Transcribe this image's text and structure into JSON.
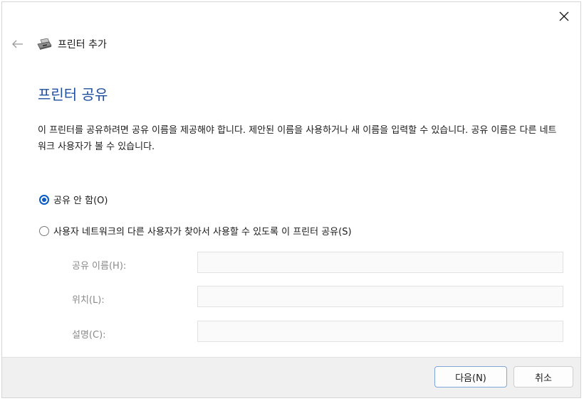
{
  "window": {
    "close_glyph": "✕",
    "back_glyph": "←",
    "wizard_title": "프린터 추가"
  },
  "page": {
    "title": "프린터 공유",
    "description": "이 프린터를 공유하려면 공유 이름을 제공해야 합니다. 제안된 이름을 사용하거나 새 이름을 입력할 수 있습니다. 공유 이름은 다른 네트워크 사용자가 볼 수 있습니다."
  },
  "options": {
    "no_share_label": "공유 안 함(O)",
    "share_label": "사용자 네트워크의 다른 사용자가 찾아서 사용할 수 있도록 이 프린터 공유(S)",
    "selected": "no_share"
  },
  "fields": {
    "share_name_label": "공유 이름(H):",
    "share_name_value": "",
    "location_label": "위치(L):",
    "location_value": "",
    "comment_label": "설명(C):",
    "comment_value": ""
  },
  "footer": {
    "next_label": "다음(N)",
    "cancel_label": "취소"
  },
  "colors": {
    "title_blue": "#1f4e9c",
    "radio_accent": "#0a5bc4",
    "disabled_text": "#8a8a8a"
  }
}
